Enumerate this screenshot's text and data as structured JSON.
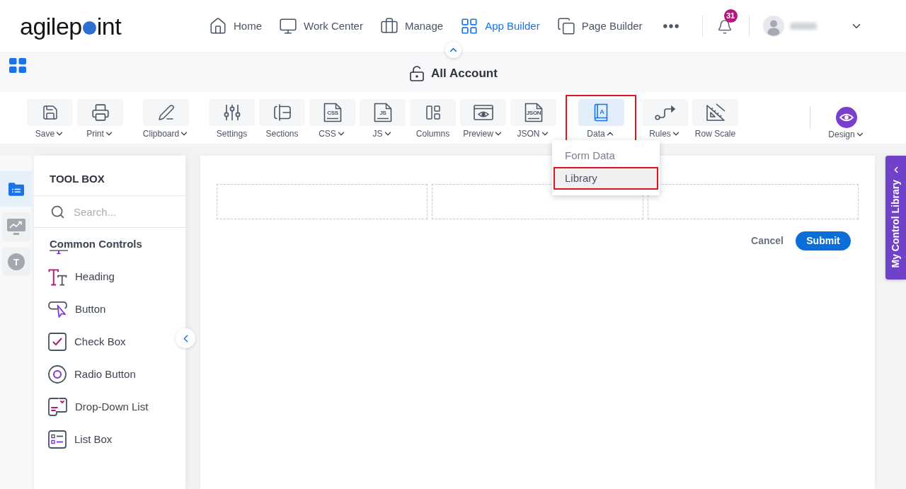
{
  "header": {
    "logo": [
      "agilep",
      "int"
    ],
    "nav": [
      {
        "label": "Home",
        "selected": false
      },
      {
        "label": "Work Center",
        "selected": false
      },
      {
        "label": "Manage",
        "selected": false
      },
      {
        "label": "App Builder",
        "selected": true
      },
      {
        "label": "Page Builder",
        "selected": false
      }
    ],
    "notification_count": "31"
  },
  "title_bar": {
    "title": "All Account"
  },
  "toolbar": {
    "groups": [
      [
        {
          "label": "Save",
          "dropdown": true,
          "expanded": false,
          "selected": false,
          "highlighted": false
        },
        {
          "label": "Print",
          "dropdown": true,
          "expanded": false,
          "selected": false,
          "highlighted": false
        }
      ],
      [
        {
          "label": "Clipboard",
          "dropdown": true,
          "expanded": false,
          "selected": false,
          "highlighted": false
        }
      ],
      [
        {
          "label": "Settings",
          "dropdown": false,
          "selected": false,
          "highlighted": false
        },
        {
          "label": "Sections",
          "dropdown": false,
          "selected": false,
          "highlighted": false
        },
        {
          "label": "CSS",
          "dropdown": true,
          "expanded": false,
          "icon_text": "CSS",
          "selected": false,
          "highlighted": false
        },
        {
          "label": "JS",
          "dropdown": true,
          "expanded": false,
          "icon_text": "JS",
          "selected": false,
          "highlighted": false
        },
        {
          "label": "Columns",
          "dropdown": false,
          "selected": false,
          "highlighted": false
        },
        {
          "label": "Preview",
          "dropdown": true,
          "expanded": false,
          "selected": false,
          "highlighted": false
        },
        {
          "label": "JSON",
          "dropdown": true,
          "expanded": false,
          "icon_text": "JSON",
          "selected": false,
          "highlighted": false
        }
      ],
      [
        {
          "label": "Data",
          "dropdown": true,
          "expanded": true,
          "icon_text": "A",
          "selected": true,
          "highlighted": true
        }
      ],
      [
        {
          "label": "Rules",
          "dropdown": true,
          "expanded": false,
          "selected": false,
          "highlighted": false
        },
        {
          "label": "Row Scale",
          "dropdown": false,
          "selected": false,
          "highlighted": false
        }
      ]
    ],
    "design": {
      "label": "Design",
      "dropdown": true,
      "expanded": false
    }
  },
  "data_menu": {
    "items": [
      {
        "label": "Form Data",
        "selected": false,
        "highlighted": false
      },
      {
        "label": "Library",
        "selected": true,
        "highlighted": true
      }
    ]
  },
  "rail": {
    "items": [
      {
        "selected": true
      },
      {
        "selected": false
      },
      {
        "selected": false,
        "icon_text": "T"
      }
    ]
  },
  "toolbox": {
    "title": "TOOL BOX",
    "search": {
      "placeholder": "Search..."
    },
    "section": "Common Controls",
    "items": [
      "Heading",
      "Button",
      "Check Box",
      "Radio Button",
      "Drop-Down List",
      "List Box"
    ]
  },
  "form": {
    "buttons": {
      "cancel": "Cancel",
      "submit": "Submit"
    }
  },
  "side_tab": {
    "label": "My Control Library"
  }
}
